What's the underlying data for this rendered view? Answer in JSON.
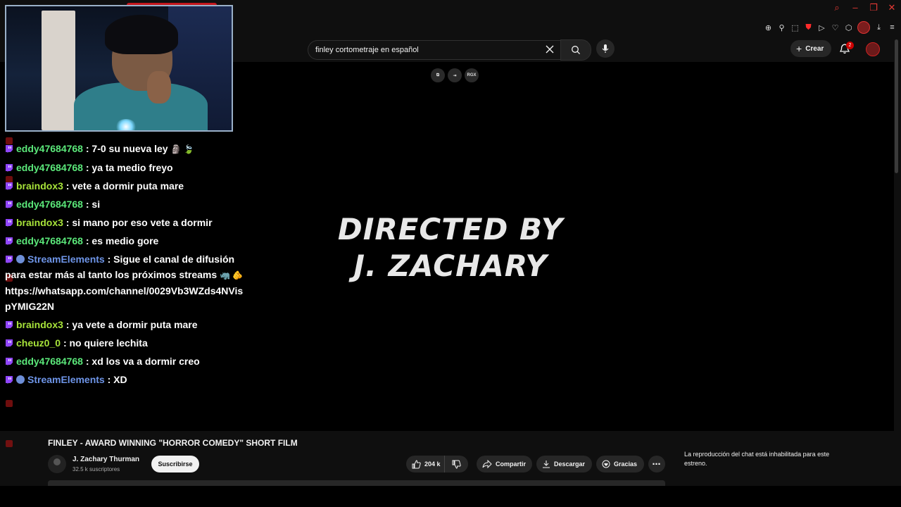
{
  "search": {
    "value": "finley cortometraje en español"
  },
  "header": {
    "create_label": "Crear",
    "notif_count": "2"
  },
  "overlay_tools": {
    "rgx_label": "RGX"
  },
  "video": {
    "credit_lines": [
      "DIRECTED BY",
      "J. ZACHARY"
    ]
  },
  "chat": {
    "messages": [
      {
        "user": "eddy47684768",
        "text": ": 7-0 su nueva ley",
        "emoji": "🗿 🍃"
      },
      {
        "user": "eddy47684768",
        "text": ": ya ta medio freyo"
      },
      {
        "user": "braindox3",
        "text": ": vete a dormir puta mare"
      },
      {
        "user": "eddy47684768",
        "text": ": si"
      },
      {
        "user": "braindox3",
        "text": ": si mano por eso vete a dormir"
      },
      {
        "user": "eddy47684768",
        "text": ": es medio gore"
      },
      {
        "user": "StreamElements",
        "text_lines": [
          ": Sigue el canal de difusión",
          "para estar más al tanto los próximos streams",
          "https://whatsapp.com/channel/0029Vb3WZds4NVis",
          "pYMIG22N"
        ],
        "emoji": "🦏 🫵"
      },
      {
        "user": "braindox3",
        "text": ": ya vete a dormir puta mare"
      },
      {
        "user": "cheuz0_0",
        "text": ": no quiere lechita"
      },
      {
        "user": "eddy47684768",
        "text": ": xd los va a dormir creo"
      },
      {
        "user": "StreamElements",
        "text": ": XD"
      }
    ]
  },
  "video_info": {
    "title": "FINLEY - AWARD WINNING \"HORROR COMEDY\" SHORT FILM",
    "channel_name": "J. Zachary Thurman",
    "subscribers": "32.5 k suscriptores",
    "subscribe_label": "Suscribirse",
    "likes": "204 k",
    "share_label": "Compartir",
    "download_label": "Descargar",
    "thanks_label": "Gracias"
  },
  "live_chat": {
    "disabled_message": "La reproducción del chat está inhabilitada para este estreno."
  },
  "colors": {
    "accent_red": "#cc0000",
    "chat_green": "#5be87a",
    "chat_lime": "#a8e43a",
    "chat_blue": "#6e95e8",
    "twitch_purple": "#9146ff"
  }
}
